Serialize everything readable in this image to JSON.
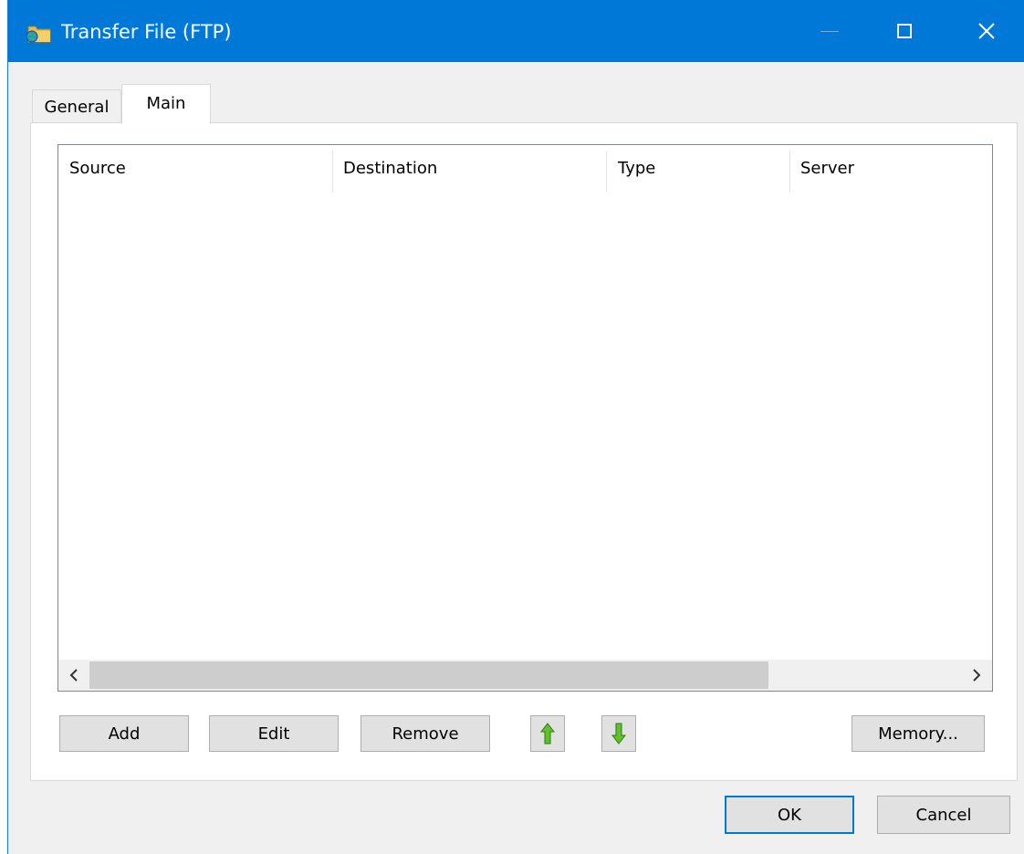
{
  "window": {
    "title": "Transfer File (FTP)",
    "icons": {
      "app": "ftp-folder-globe-icon",
      "minimize": "minimize-icon",
      "maximize": "maximize-icon",
      "close": "close-icon"
    }
  },
  "tabs": [
    {
      "label": "General",
      "selected": false
    },
    {
      "label": "Main",
      "selected": true
    }
  ],
  "table": {
    "columns": [
      "Source",
      "Destination",
      "Type",
      "Server"
    ],
    "rows": []
  },
  "buttons": {
    "add": "Add",
    "edit": "Edit",
    "remove": "Remove",
    "move_up_icon": "green-up-arrow-icon",
    "move_down_icon": "green-down-arrow-icon",
    "memory": "Memory...",
    "ok": "OK",
    "cancel": "Cancel"
  },
  "colors": {
    "titlebar": "#0078d7",
    "accent": "#0078d7",
    "arrow_green": "#3a9a15"
  }
}
